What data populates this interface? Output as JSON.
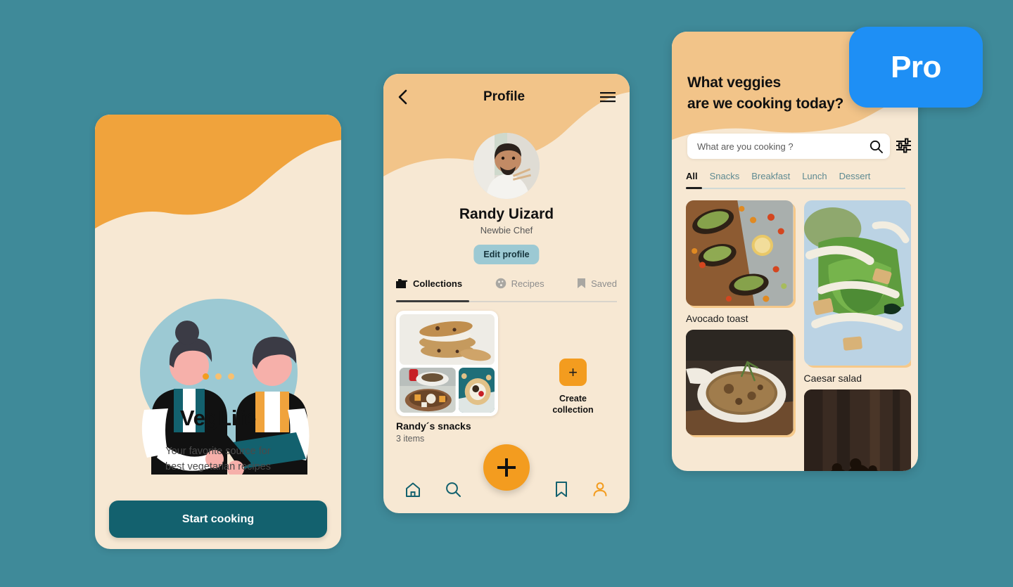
{
  "canvas": {
    "background_color": "#3F8A99"
  },
  "pro_badge": {
    "label": "Pro",
    "color": "#1E8FF5"
  },
  "onboarding": {
    "title": "VegLife",
    "subtitle_line1": "Your favorite source for",
    "subtitle_line2": "best vegetarian recipes",
    "cta_label": "Start cooking",
    "cta_color": "#13616E",
    "dots": {
      "total": 3,
      "active_index": 0,
      "active_color": "#F39C1F",
      "inactive_color": "#F8C070"
    },
    "illustration": "two-chefs-illustration"
  },
  "profile": {
    "header_title": "Profile",
    "back_icon": "chevron-left-icon",
    "menu_icon": "hamburger-menu-icon",
    "name": "Randy Uizard",
    "role": "Newbie Chef",
    "edit_label": "Edit profile",
    "edit_color": "#9CC9D3",
    "avatar": "user-avatar-photo",
    "tabs": [
      {
        "label": "Collections",
        "icon": "folder-icon",
        "active": true
      },
      {
        "label": "Recipes",
        "icon": "cookie-icon",
        "active": false
      },
      {
        "label": "Saved",
        "icon": "bookmark-icon",
        "active": false
      }
    ],
    "collection": {
      "name": "Randy´s snacks",
      "count": "3 items",
      "photos": [
        "cookie-sandwich-photo",
        "cheese-board-photo",
        "bagel-photo"
      ]
    },
    "create": {
      "plus": "+",
      "line1": "Create",
      "line2": "collection",
      "color": "#F39C1F"
    },
    "nav": [
      {
        "name": "home",
        "icon": "home-icon",
        "active": false
      },
      {
        "name": "search",
        "icon": "search-icon",
        "active": false
      },
      {
        "name": "saved",
        "icon": "bookmark-icon",
        "active": false
      },
      {
        "name": "profile",
        "icon": "person-icon",
        "active": true
      }
    ],
    "fab": {
      "icon": "plus-icon",
      "color": "#F39C1F"
    }
  },
  "discover": {
    "title_line1": "What veggies",
    "title_line2": "are we cooking today?",
    "search": {
      "placeholder": "What are you cooking ?",
      "value": "",
      "icon": "search-icon"
    },
    "filter_icon": "sliders-filter-icon",
    "tabs": [
      {
        "label": "All",
        "active": true
      },
      {
        "label": "Snacks",
        "active": false
      },
      {
        "label": "Breakfast",
        "active": false
      },
      {
        "label": "Lunch",
        "active": false
      },
      {
        "label": "Dessert",
        "active": false
      }
    ],
    "cards_left": [
      {
        "caption": "Avocado toast",
        "photo": "avocado-toast-photo"
      },
      {
        "caption": "",
        "photo": "mushroom-risotto-photo"
      }
    ],
    "cards_right": [
      {
        "caption": "Caesar salad",
        "photo": "caesar-salad-photo"
      },
      {
        "caption": "",
        "photo": "chocolate-dessert-photo"
      }
    ]
  }
}
